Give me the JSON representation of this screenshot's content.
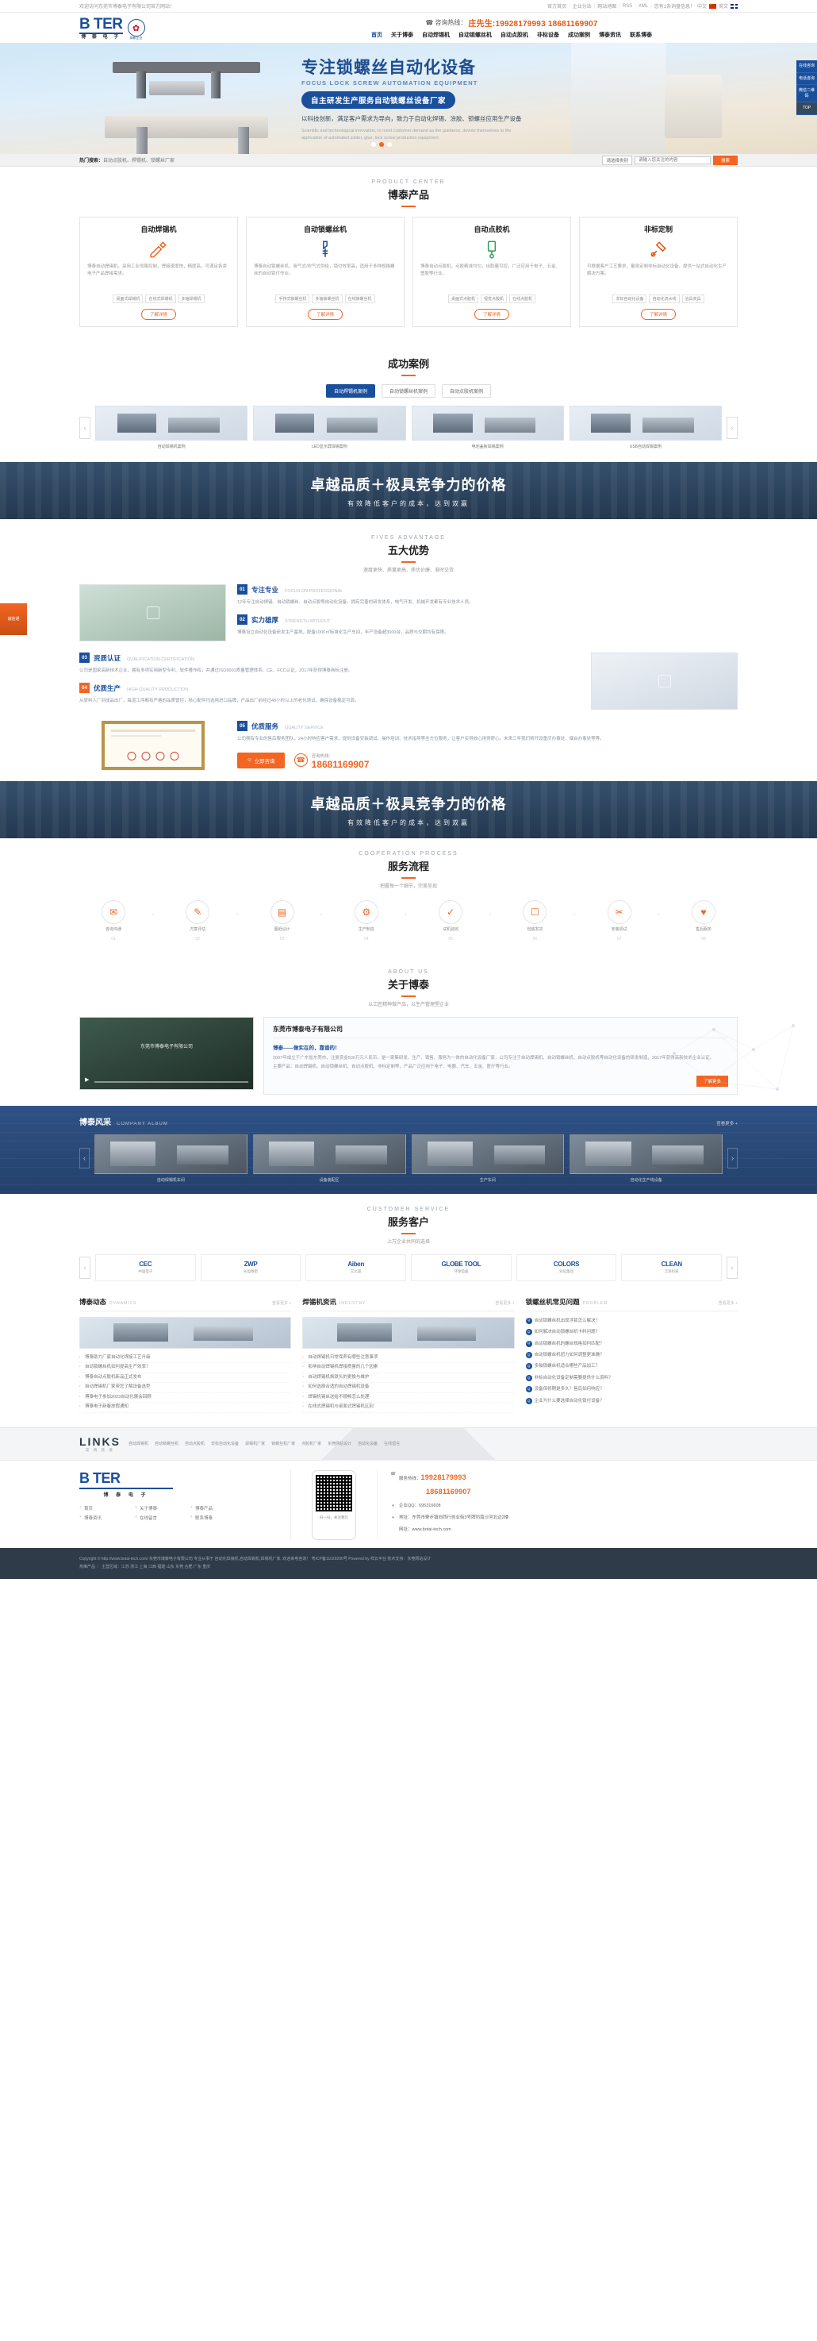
{
  "topbar": {
    "welcome": "欢迎访问东莞市博泰电子有限公司官方网站！",
    "links": [
      "官方首页",
      "企业分站",
      "网站地图",
      "RSS",
      "XML",
      "您有1条询盘信息！"
    ],
    "lang_cn": "中文",
    "lang_en": "英文"
  },
  "header": {
    "logo_word": "B TER",
    "logo_sub": "博 泰 电 子",
    "badge_sub": "高新企业",
    "hotline_label": "咨询热线：",
    "hotline_value": "庄先生:19928179993 18681169907",
    "nav": [
      {
        "label": "首页",
        "active": true
      },
      {
        "label": "关于博泰",
        "active": false
      },
      {
        "label": "自动焊锡机",
        "active": false
      },
      {
        "label": "自动锁螺丝机",
        "active": false
      },
      {
        "label": "自动点胶机",
        "active": false
      },
      {
        "label": "非标设备",
        "active": false
      },
      {
        "label": "成功案例",
        "active": false
      },
      {
        "label": "博泰资讯",
        "active": false
      },
      {
        "label": "联系博泰",
        "active": false
      }
    ]
  },
  "floatbar": [
    "在线咨询",
    "电话咨询",
    "微信二维码",
    "TOP"
  ],
  "banner": {
    "title": "专注锁螺丝自动化设备",
    "subtitle": "FOCUS LOCK SCREW AUTOMATION EQUIPMENT",
    "pill": "自主研发生产服务自动锁螺丝设备厂家",
    "desc": "以科技创新，满足客户需求为导向，致力于自动化焊锡、涂胶、锁螺丝应用生产设备",
    "eng": "Scientific and technological innovation, to meet customer demand as the guidance, devote themselves to the application of automated solder, glue, lock screw production equipment"
  },
  "search": {
    "hot_label": "热门搜索：",
    "hot_words": "自动点胶机、焊锡机、锁螺丝厂家",
    "select_value": "请选择类别",
    "placeholder": "请输入您关注的内容",
    "button": "搜索"
  },
  "product_center": {
    "en": "PRODUCT CENTER",
    "cn": "博泰产品",
    "cards": [
      {
        "title": "自动焊锡机",
        "icon": "solder-icon",
        "desc": "博泰自动焊锡机，采用工业伺服控制，焊接速度快，精度高，可满足各类电子产品焊接需求。",
        "tags": [
          "桌面式焊锡机",
          "在线式焊锡机",
          "多轴焊锡机"
        ],
        "more": "了解详情"
      },
      {
        "title": "自动锁螺丝机",
        "icon": "screw-icon",
        "desc": "博泰自动锁螺丝机，吸气式/吹气式供给，锁付效率高，适用于多种规格螺丝的自动锁付作业。",
        "tags": [
          "手持式锁螺丝机",
          "多轴锁螺丝机",
          "在线锁螺丝机"
        ],
        "more": "了解详情"
      },
      {
        "title": "自动点胶机",
        "icon": "glue-icon",
        "desc": "博泰自动点胶机，点胶精准均匀，出胶量可控，广泛应用于电子、五金、塑胶等行业。",
        "tags": [
          "桌面式点胶机",
          "视觉点胶机",
          "在线点胶机"
        ],
        "more": "了解详情"
      },
      {
        "title": "非标定制",
        "icon": "custom-icon",
        "desc": "可根据客户工艺要求，量身定制非标自动化设备，提供一站式自动化生产解决方案。",
        "tags": [
          "非标自动化设备",
          "自动化流水线",
          "治具夹具"
        ],
        "more": "了解详情"
      }
    ]
  },
  "cases": {
    "cn": "成功案例",
    "tabs": [
      {
        "label": "自动焊锡机案例",
        "on": true
      },
      {
        "label": "自动锁螺丝机案例",
        "on": false
      },
      {
        "label": "自动点胶机案例",
        "on": false
      }
    ],
    "items": [
      {
        "caption": "自动焊锡机案例"
      },
      {
        "caption": "LED显示屏焊锡案例"
      },
      {
        "caption": "电池盖板焊锡案例"
      },
      {
        "caption": "USB自动焊锡案例"
      }
    ],
    "prev": "‹",
    "next": "›"
  },
  "slogan": {
    "title": "卓越品质＋极具竞争力的价格",
    "sub": "有效降低客户的成本，达到双赢"
  },
  "advantage": {
    "en": "FIVES ADVANTAGE",
    "cn": "五大优势",
    "sub": "速度更快、质量更高、质优价廉、准时交货",
    "items": [
      {
        "num": "01",
        "title": "专注专业",
        "en": "FOCUS ON PROFESSIONAL",
        "desc": "12年专注自动焊锡、自动锁螺丝、自动点胶等自动化设备，拥有完善的研发体系，电气开发、机械开发都有专业技术人员。"
      },
      {
        "num": "02",
        "title": "实力雄厚",
        "en": "STRENGTH WITHOUT",
        "desc": "博泰设立自动化设备研发生产基地，配备1000㎡标准化生产车间，年产设备超3000台，品质与交期均有保障。"
      },
      {
        "num": "03",
        "title": "资质认证",
        "en": "QUALIFICATION CERTIFICATION",
        "desc": "公司是国家高新技术企业，拥有多项实用新型专利、软件著作权，并通过ISO9001质量管理体系、CE、FCC认证，2017年获得博泰商标注册。"
      },
      {
        "num": "04",
        "title": "优质生产",
        "en": "HIGH QUALITY PRODUCTION",
        "desc": "从原料入厂到成品出厂，每道工序都有严格的品质管控，核心配件均选用进口品牌，产品出厂前经过48小时以上的老化测试，确保设备稳定可靠。"
      },
      {
        "num": "05",
        "title": "优质服务",
        "en": "QUALITY SERVICE",
        "desc": "公司拥有专业的售后服务团队，24小时响应客户需求，提供设备安装调试、操作培训、技术指导等全方位服务，让客户买得放心用得舒心。未来三年我们将开设重庆办事处、烟台办事处等等。"
      }
    ],
    "cta_button": "立即咨询",
    "cta_label": "咨询热线：",
    "cta_phone": "18681169907"
  },
  "slogan2": {
    "title": "卓越品质＋极具竞争力的价格",
    "sub": "有效降低客户的成本，达到双赢"
  },
  "process": {
    "en": "COOPERATION PROCESS",
    "cn": "服务流程",
    "sub": "把握每一个细节，完美呈现",
    "steps": [
      {
        "num": "01",
        "label": "咨询沟通",
        "icon": "chat-icon"
      },
      {
        "num": "02",
        "label": "方案评估",
        "icon": "doc-icon"
      },
      {
        "num": "03",
        "label": "图纸设计",
        "icon": "draw-icon"
      },
      {
        "num": "04",
        "label": "生产制造",
        "icon": "gear-icon"
      },
      {
        "num": "05",
        "label": "试机验收",
        "icon": "check-icon"
      },
      {
        "num": "06",
        "label": "包装发货",
        "icon": "box-icon"
      },
      {
        "num": "07",
        "label": "安装调试",
        "icon": "tool-icon"
      },
      {
        "num": "08",
        "label": "售后服务",
        "icon": "service-icon"
      }
    ]
  },
  "about": {
    "en": "ABOUT US",
    "cn": "关于博泰",
    "sub": "以工匠精神做产品，以生产管理塑企业",
    "video_title": "东莞市博泰电子有限公司",
    "card_title": "东莞市博泰电子有限公司",
    "card_sub": "博泰——做实在的，靠谱的！",
    "card_desc": "2007年成立于广东省东莞市，注册资金500万元人民币，是一家集研发、生产、销售、服务为一体的自动化设备厂家，公司专注于自动焊锡机、自动锁螺丝机、自动点胶机等自动化设备的研发制造，2017年获得高新技术企业认证。",
    "card_desc2": "主要产品：自动焊锡机、自动锁螺丝机、自动点胶机、非标定制等，产品广泛应用于电子、电器、汽车、五金、医疗等行业。",
    "more": "了解更多"
  },
  "album": {
    "title": "博泰风采",
    "en": "COMPANY ALBUM",
    "more": "查看更多 +",
    "items": [
      {
        "caption": "自动焊锡机车间"
      },
      {
        "caption": "设备装配区"
      },
      {
        "caption": "生产车间"
      },
      {
        "caption": "自动化生产线设备"
      }
    ],
    "prev": "‹",
    "next": "›"
  },
  "customers": {
    "en": "CUSTOMER SERVICE",
    "cn": "服务客户",
    "sub": "上万企业共同的选择",
    "items": [
      {
        "name": "CEC",
        "sub": "中国电子"
      },
      {
        "name": "ZWP",
        "sub": "长盈精密"
      },
      {
        "name": "Aibеn",
        "sub": "艾比森"
      },
      {
        "name": "GLOBE TOOL",
        "sub": "环球电器"
      },
      {
        "name": "COLORS",
        "sub": "彩虹集团"
      },
      {
        "name": "CLEAN",
        "sub": "洁净科技"
      }
    ],
    "prev": "‹",
    "next": "›"
  },
  "news": {
    "columns": [
      {
        "title": "博泰动态",
        "en": "DYNAMICS",
        "more": "查看更多 +",
        "items": [
          "博泰助力厂家自动化焊接工艺升级",
          "自动锁螺丝机如何提高生产效率？",
          "博泰自动点胶机新品正式发布",
          "自动焊锡机厂家带您了解设备选型",
          "博泰电子参加2023自动化展会回顾",
          "博泰电子新春放假通知"
        ]
      },
      {
        "title": "焊锡机资讯",
        "en": "INDUSTRY",
        "more": "查看更多 +",
        "items": [
          "自动焊锡机日常保养有哪些注意事项",
          "影响自动焊锡机焊接质量的几个因素",
          "自动焊锡机烙铁头的更换与维护",
          "如何选择合适的自动焊锡机设备",
          "焊锡机锡丝送给不顺畅怎么处理",
          "在线式焊锡机与桌面式焊锡机区别"
        ]
      },
      {
        "title": "锁螺丝机常见问题",
        "en": "PROBLEM",
        "more": "查看更多 +",
        "items": [
          "自动锁螺丝机出现浮锁怎么解决？",
          "如何解决自动锁螺丝机卡料问题？",
          "自动锁螺丝机的螺丝规格如何匹配？",
          "自动锁螺丝机扭力如何调整更准确？",
          "多轴锁螺丝机适合哪些产品加工？",
          "非标自动化设备定制需要提供什么资料？",
          "设备保修期是多久？售后如何响应？",
          "企业为什么要选择自动化锁付设备？"
        ]
      }
    ]
  },
  "links": {
    "title": "LINKS",
    "sub": "友 情 链 接",
    "items": [
      "自动焊锡机",
      "自动锁螺丝机",
      "自动点胶机",
      "非标自动化设备",
      "焊锡机厂家",
      "锁螺丝机厂家",
      "点胶机厂家",
      "东莞网站设计",
      "自动化设备",
      "在线留言"
    ]
  },
  "footer": {
    "logo_word": "B TER",
    "logo_sub": "博 泰 电 子",
    "nav": [
      "首页",
      "关于博泰",
      "博泰产品",
      "博泰资讯",
      "在线留言",
      "联系博泰"
    ],
    "qr_caption": "扫一扫，关注我们",
    "service_label": "服务热线：",
    "phone1": "19928179993",
    "phone2": "18681169907",
    "qq_label": "企业QQ：",
    "qq_value": "695316608",
    "addr_label": "地址：",
    "addr_value": "东莞市寮步镇向西行创业街3号牌坊南沙河北边2楼",
    "web_label": "网址：",
    "web_value": "www.botai-tech.com"
  },
  "copyright": {
    "line1": "Copyright © http://www.botai-tech.com/ 东莞市博泰电子有限公司 专业从事于 自动化焊接机,自动焊锡机,焊锡机厂家, 欢迎来电咨询！    粤ICP备11029206号    Powered by 祥云平台  技术支持：东莞网站设计",
    "line2": "热推产品 ｜ 主营区域：江苏 浙江 上海 江西 福建 山东 东莞 合肥 广东 重庆"
  },
  "side_badge": "诚信通"
}
